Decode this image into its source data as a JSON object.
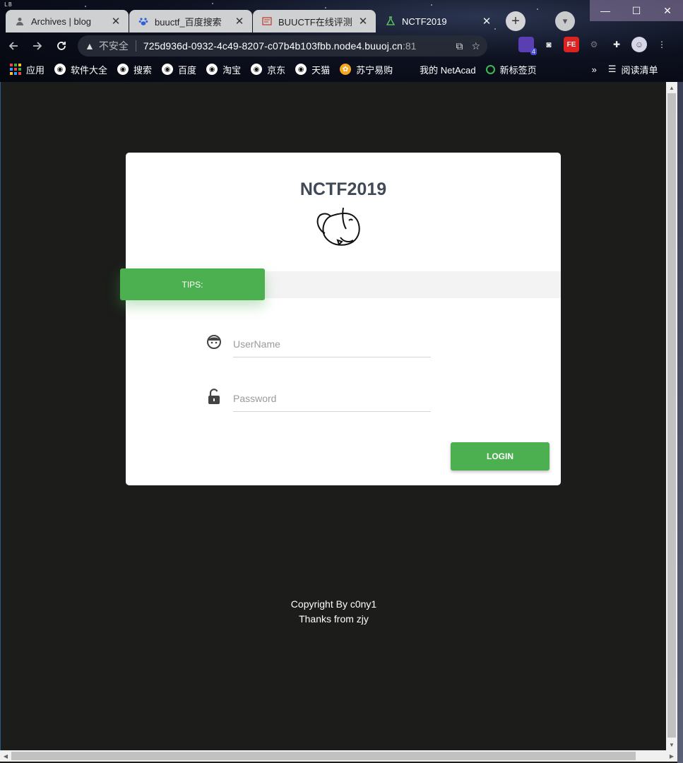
{
  "window": {
    "brand": "LB",
    "controls": {
      "minimize": "—",
      "maximize": "☐",
      "close": "✕"
    }
  },
  "tabs": [
    {
      "title": "Archives | blog",
      "favicon": "person-icon",
      "active": false
    },
    {
      "title": "buuctf_百度搜索",
      "favicon": "baidu-paw-icon",
      "active": false
    },
    {
      "title": "BUUCTF在线评测",
      "favicon": "buuctf-icon",
      "active": false
    },
    {
      "title": "NCTF2019",
      "favicon": "flask-icon",
      "active": true
    }
  ],
  "toolbar": {
    "security_label": "不安全",
    "url_host": "725d936d-0932-4c49-8207-c07b4b103fbb.node4.buuoj.cn",
    "url_port": ":81",
    "extension_badge": "4"
  },
  "bookmarks": {
    "apps": "应用",
    "items": [
      "软件大全",
      "搜索",
      "百度",
      "淘宝",
      "京东",
      "天猫",
      "苏宁易购",
      "我的 NetAcad",
      "新标签页"
    ],
    "overflow": "»",
    "reading_list": "阅读清单"
  },
  "login": {
    "title": "NCTF2019",
    "tips_label": "TIPS:",
    "username_placeholder": "UserName",
    "password_placeholder": "Password",
    "login_label": "LOGIN",
    "accent_color": "#4caf50"
  },
  "footer": {
    "line1": "Copyright By c0ny1",
    "line2": "Thanks from zjy"
  }
}
